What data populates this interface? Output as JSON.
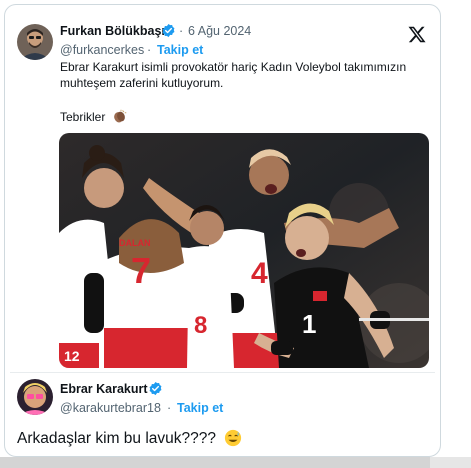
{
  "main_tweet": {
    "author_name": "Furkan Bölükbaşı",
    "dot": "·",
    "date": "6 Ağu 2024",
    "handle": "@furkancerkes",
    "follow_label": "Takip et",
    "text_line1": "Ebrar Karakurt isimli provokatör hariç Kadın Voleybol takımımızın",
    "text_line2": "muhteşem zaferini kutluyorum.",
    "text_line3": "Tebrikler",
    "media": {
      "jersey_numbers": [
        "7",
        "4",
        "1",
        "8",
        "12"
      ],
      "jersey_text": "DALAN"
    }
  },
  "reply_tweet": {
    "author_name": "Ebrar Karakurt",
    "handle": "@karakurtebrar18",
    "follow_label": "Takip et",
    "text": "Arkadaşlar kim bu lavuk????"
  },
  "colors": {
    "verified_blue": "#1d9bf0",
    "link_blue": "#1d9bf0",
    "jersey_red": "#d7262f"
  },
  "icons": [
    "x-logo-icon",
    "verified-badge-icon",
    "clapping-hands-emoji",
    "sweat-smile-emoji"
  ]
}
